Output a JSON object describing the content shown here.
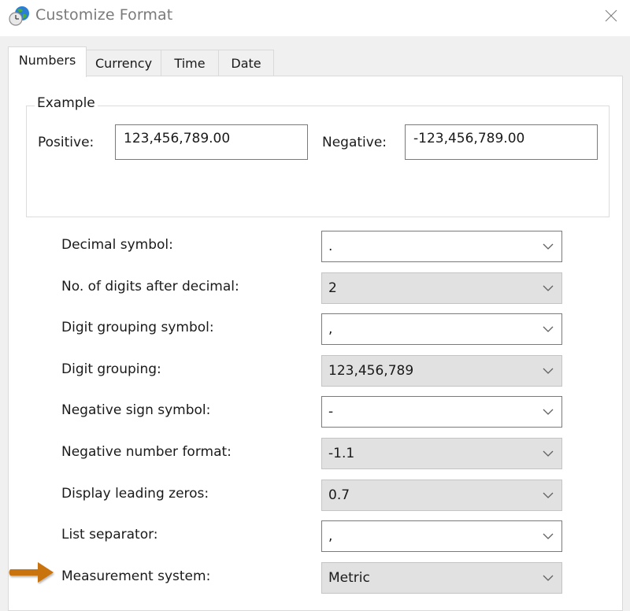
{
  "window": {
    "title": "Customize Format",
    "icon": "globe-clock-icon",
    "close_icon": "close-icon"
  },
  "tabs": [
    {
      "label": "Numbers",
      "selected": true
    },
    {
      "label": "Currency",
      "selected": false
    },
    {
      "label": "Time",
      "selected": false
    },
    {
      "label": "Date",
      "selected": false
    }
  ],
  "example": {
    "legend": "Example",
    "positive_label": "Positive:",
    "positive_value": "123,456,789.00",
    "negative_label": "Negative:",
    "negative_value": "-123,456,789.00"
  },
  "settings": [
    {
      "label": "Decimal symbol:",
      "value": ".",
      "editable": true
    },
    {
      "label": "No. of digits after decimal:",
      "value": "2",
      "editable": false
    },
    {
      "label": "Digit grouping symbol:",
      "value": ",",
      "editable": true
    },
    {
      "label": "Digit grouping:",
      "value": "123,456,789",
      "editable": false
    },
    {
      "label": "Negative sign symbol:",
      "value": "-",
      "editable": true
    },
    {
      "label": "Negative number format:",
      "value": "-1.1",
      "editable": false
    },
    {
      "label": "Display leading zeros:",
      "value": "0.7",
      "editable": false
    },
    {
      "label": "List separator:",
      "value": ",",
      "editable": true
    },
    {
      "label": "Measurement system:",
      "value": "Metric",
      "editable": false
    }
  ],
  "annotation": {
    "icon": "arrow-right-icon",
    "color": "#c8730f",
    "points_to": "Measurement system:"
  }
}
